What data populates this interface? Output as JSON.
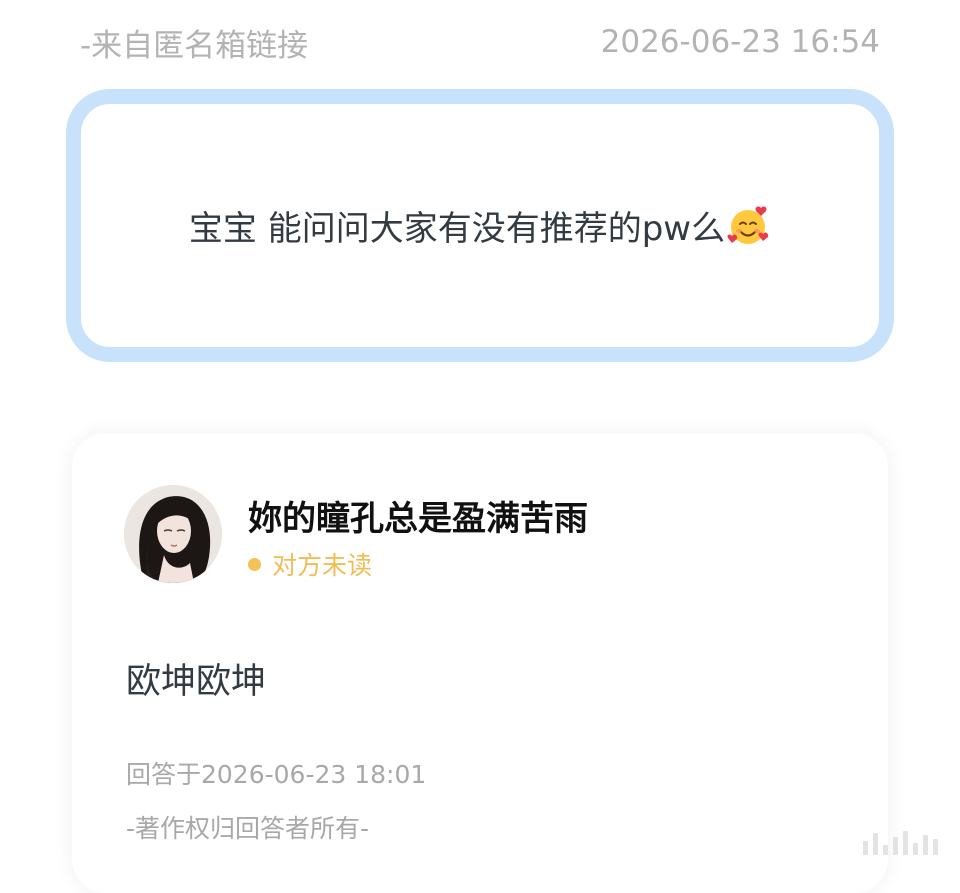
{
  "meta": {
    "source": "-来自匿名箱链接",
    "timestamp": "2026-06-23 16:54"
  },
  "question": {
    "text": "宝宝 能问问大家有没有推荐的pw么",
    "emoji": "smiling-face-with-hearts"
  },
  "answer": {
    "username": "妳的瞳孔总是盈满苦雨",
    "status": "对方未读",
    "body": "欧坤欧坤",
    "answered_at": "回答于2026-06-23 18:01",
    "copyright": "-著作权归回答者所有-"
  },
  "colors": {
    "question_border": "#c8e2fb",
    "status": "#f2bc55",
    "meta_text": "#b3b3b3"
  }
}
